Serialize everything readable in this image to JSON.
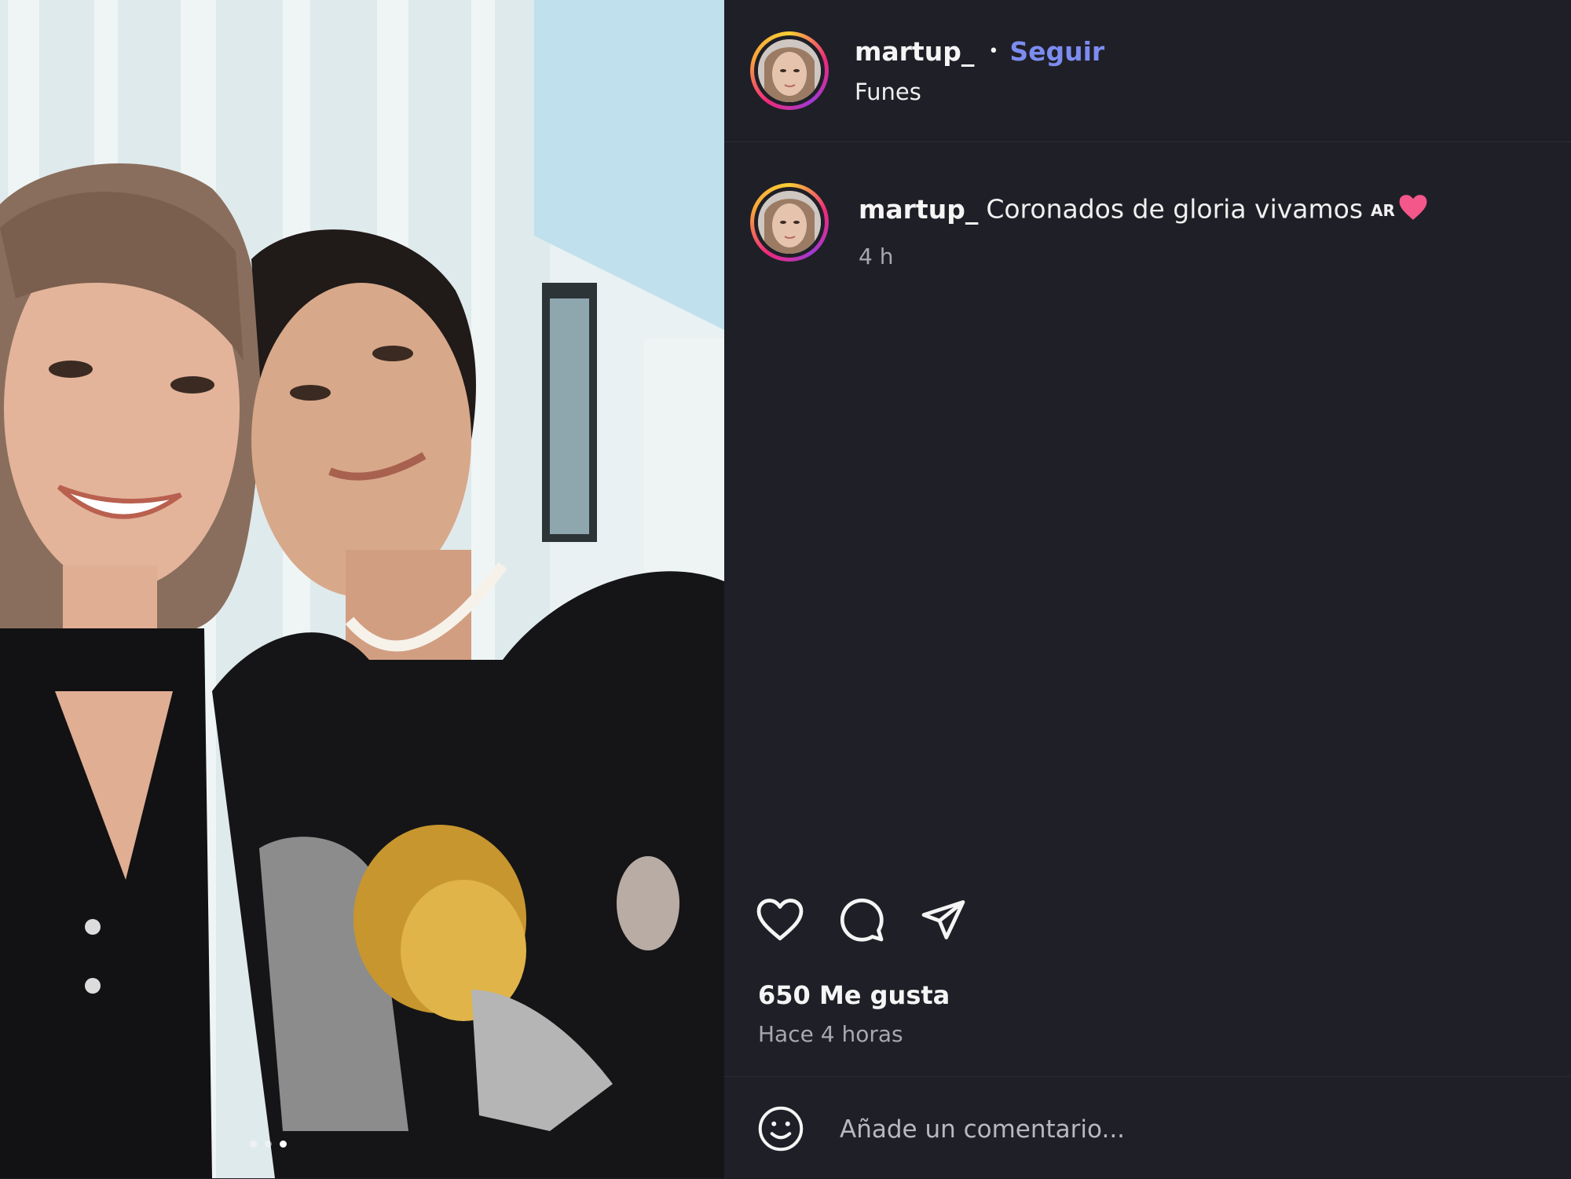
{
  "post": {
    "author": {
      "username": "martup_",
      "follow_label": "Seguir",
      "location": "Funes"
    },
    "caption": {
      "username": "martup_",
      "text": "Coronados de gloria vivamos",
      "flag": "AR",
      "time": "4 h"
    },
    "likes": "650 Me gusta",
    "posted": "Hace 4 horas",
    "carousel": {
      "total": 3,
      "active_index": 2
    }
  },
  "comment": {
    "placeholder": "Añade un comentario..."
  },
  "icons": {
    "like": "heart-icon",
    "comment": "comment-bubble-icon",
    "share": "paper-plane-icon",
    "emoji": "smiley-icon"
  },
  "colors": {
    "background": "#1f1f27",
    "follow": "#7c8cf0",
    "heart_emoji": "#f4578a",
    "muted_text": "#a8a8b0"
  }
}
